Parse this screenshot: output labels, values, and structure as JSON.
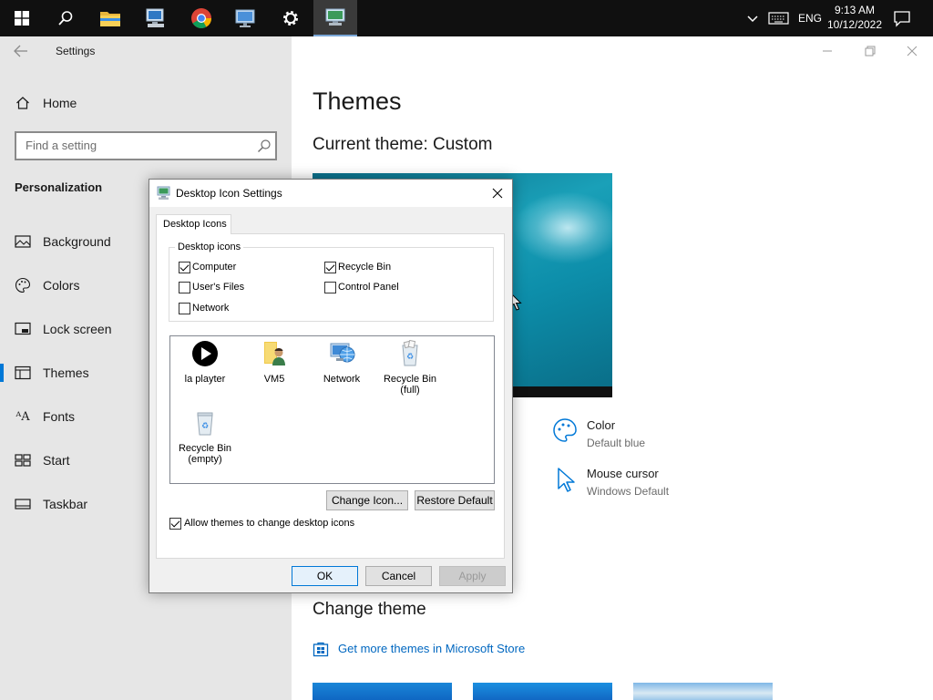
{
  "taskbar": {
    "language": "ENG",
    "time": "9:13 AM",
    "date": "10/12/2022"
  },
  "settings": {
    "window_title": "Settings",
    "home_label": "Home",
    "search_placeholder": "Find a setting",
    "section_title": "Personalization",
    "nav_items": [
      {
        "label": "Background",
        "icon": "image-icon"
      },
      {
        "label": "Colors",
        "icon": "palette-icon"
      },
      {
        "label": "Lock screen",
        "icon": "lock-screen-icon"
      },
      {
        "label": "Themes",
        "icon": "themes-icon"
      },
      {
        "label": "Fonts",
        "icon": "fonts-icon"
      },
      {
        "label": "Start",
        "icon": "start-icon"
      },
      {
        "label": "Taskbar",
        "icon": "taskbar-icon"
      }
    ],
    "selected_nav": "Themes"
  },
  "themes_page": {
    "title": "Themes",
    "current_theme": "Current theme: Custom",
    "color_label": "Color",
    "color_value": "Default blue",
    "cursor_label": "Mouse cursor",
    "cursor_value": "Windows Default",
    "change_theme_title": "Change theme",
    "store_link": "Get more themes in Microsoft Store"
  },
  "dialog": {
    "title": "Desktop Icon Settings",
    "tab_label": "Desktop Icons",
    "group_label": "Desktop icons",
    "checkboxes": [
      {
        "label": "Computer",
        "checked": true
      },
      {
        "label": "Recycle Bin",
        "checked": true
      },
      {
        "label": "User's Files",
        "checked": false
      },
      {
        "label": "Control Panel",
        "checked": false
      },
      {
        "label": "Network",
        "checked": false
      }
    ],
    "icons": [
      {
        "label": "la playter",
        "icon": "play-icon"
      },
      {
        "label": "VM5",
        "icon": "user-folder-icon"
      },
      {
        "label": "Network",
        "icon": "network-icon"
      },
      {
        "label": "Recycle Bin (full)",
        "line1": "Recycle Bin",
        "line2": "(full)",
        "icon": "recycle-bin-full-icon"
      },
      {
        "label": "Recycle Bin (empty)",
        "line1": "Recycle Bin",
        "line2": "(empty)",
        "icon": "recycle-bin-empty-icon"
      }
    ],
    "change_icon_label": "Change Icon...",
    "restore_default_label": "Restore Default",
    "allow_themes_label": "Allow themes to change desktop icons",
    "allow_themes_checked": true,
    "ok_label": "OK",
    "cancel_label": "Cancel",
    "apply_label": "Apply"
  },
  "colors": {
    "accent": "#0078d7",
    "link": "#0067c0",
    "taskbar": "#101010",
    "left_pane": "#e6e6e6"
  }
}
